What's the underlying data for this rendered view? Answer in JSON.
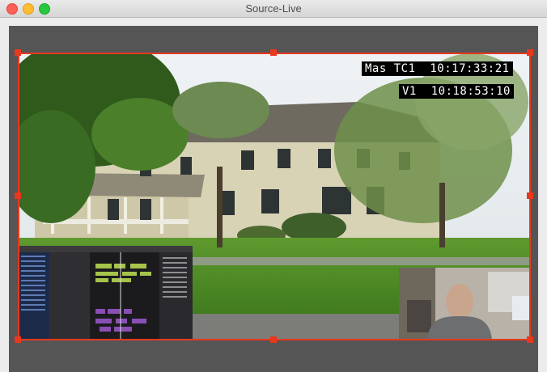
{
  "window": {
    "title": "Source-Live"
  },
  "overlays": {
    "timecode_master_label": "Mas TC1",
    "timecode_master_value": "10:17:33:21",
    "timecode_video_label": "V1",
    "timecode_video_value": "10:18:53:10"
  },
  "colors": {
    "selection": "#e8381e",
    "canvas": "#555555",
    "timecode_bg": "#000000",
    "timecode_text": "#ffffff"
  },
  "icons": {
    "close": "close-icon",
    "minimize": "minimize-icon",
    "zoom": "zoom-icon"
  }
}
